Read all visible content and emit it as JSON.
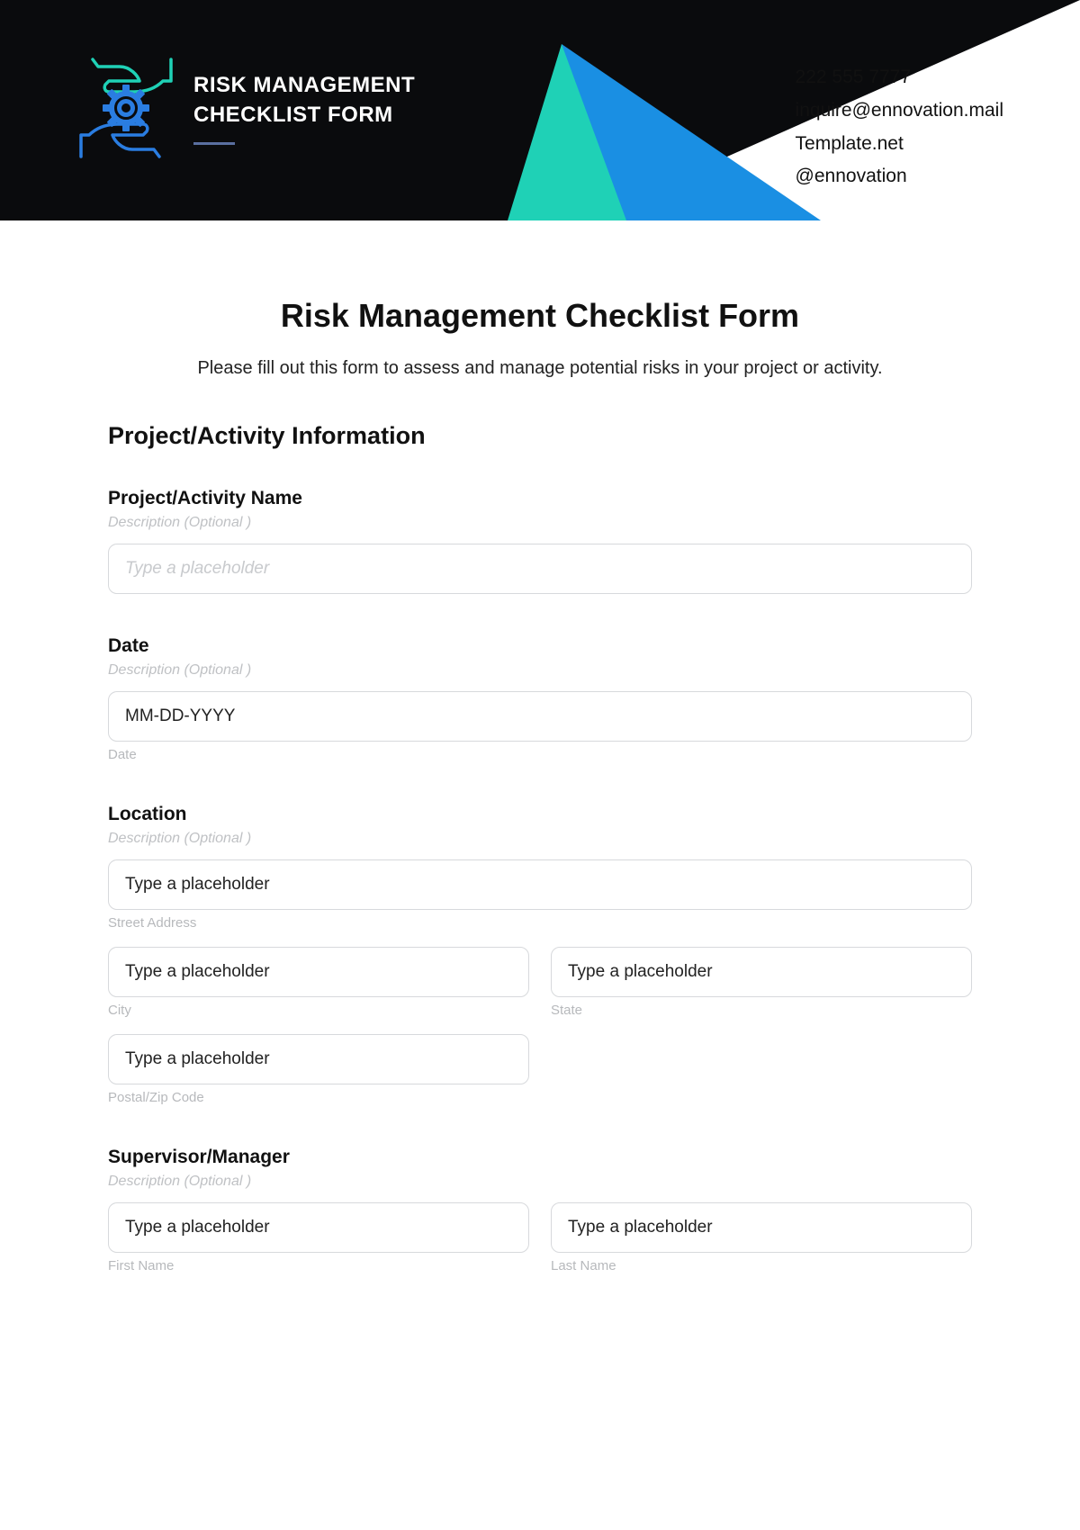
{
  "header": {
    "title_line1": "RISK MANAGEMENT",
    "title_line2": "CHECKLIST FORM",
    "contact": {
      "phone": "222 555 7777",
      "email": "inquire@ennovation.mail",
      "site": "Template.net",
      "handle": "@ennovation"
    }
  },
  "page": {
    "title": "Risk Management Checklist Form",
    "subtitle": "Please fill out this form to assess and manage potential risks in your project or activity."
  },
  "section1": {
    "heading": "Project/Activity Information",
    "name_label": "Project/Activity Name",
    "desc_hint": "Description (Optional )",
    "name_placeholder": "Type a placeholder",
    "date_label": "Date",
    "date_placeholder": "MM-DD-YYYY",
    "date_sub": "Date",
    "location_label": "Location",
    "street_placeholder": "Type a placeholder",
    "street_sub": "Street Address",
    "city_placeholder": "Type a placeholder",
    "city_sub": "City",
    "state_placeholder": "Type a placeholder",
    "state_sub": "State",
    "postal_placeholder": "Type a placeholder",
    "postal_sub": "Postal/Zip Code",
    "supervisor_label": "Supervisor/Manager",
    "first_placeholder": "Type a placeholder",
    "first_sub": "First Name",
    "last_placeholder": "Type a placeholder",
    "last_sub": "Last Name"
  }
}
